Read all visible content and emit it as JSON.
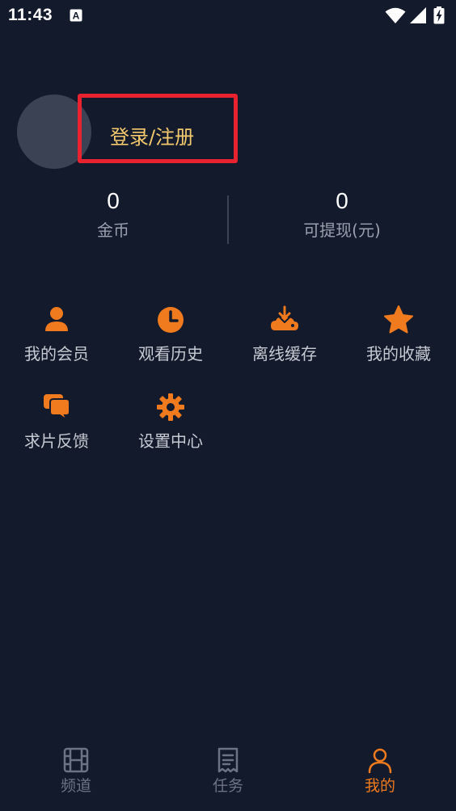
{
  "status_bar": {
    "time": "11:43",
    "notification_icon": "a-notification-icon",
    "icons": [
      "wifi-icon",
      "signal-icon",
      "battery-charging-icon"
    ]
  },
  "profile": {
    "login_label": "登录/注册",
    "avatar_icon": "avatar-placeholder"
  },
  "stats": [
    {
      "value": "0",
      "label": "金币"
    },
    {
      "value": "0",
      "label": "可提现(元)"
    }
  ],
  "menu": [
    {
      "label": "我的会员",
      "icon": "user-icon"
    },
    {
      "label": "观看历史",
      "icon": "clock-icon"
    },
    {
      "label": "离线缓存",
      "icon": "cloud-download-icon"
    },
    {
      "label": "我的收藏",
      "icon": "star-icon"
    },
    {
      "label": "求片反馈",
      "icon": "chat-bubbles-icon"
    },
    {
      "label": "设置中心",
      "icon": "gear-icon"
    }
  ],
  "bottom_nav": [
    {
      "label": "频道",
      "icon": "film-icon",
      "active": false
    },
    {
      "label": "任务",
      "icon": "task-list-icon",
      "active": false
    },
    {
      "label": "我的",
      "icon": "person-icon",
      "active": true
    }
  ],
  "colors": {
    "background": "#131a2b",
    "accent": "#f07a1e",
    "login_text": "#f3c96e",
    "highlight_box": "#e8232f",
    "inactive_nav": "#6c7383"
  }
}
